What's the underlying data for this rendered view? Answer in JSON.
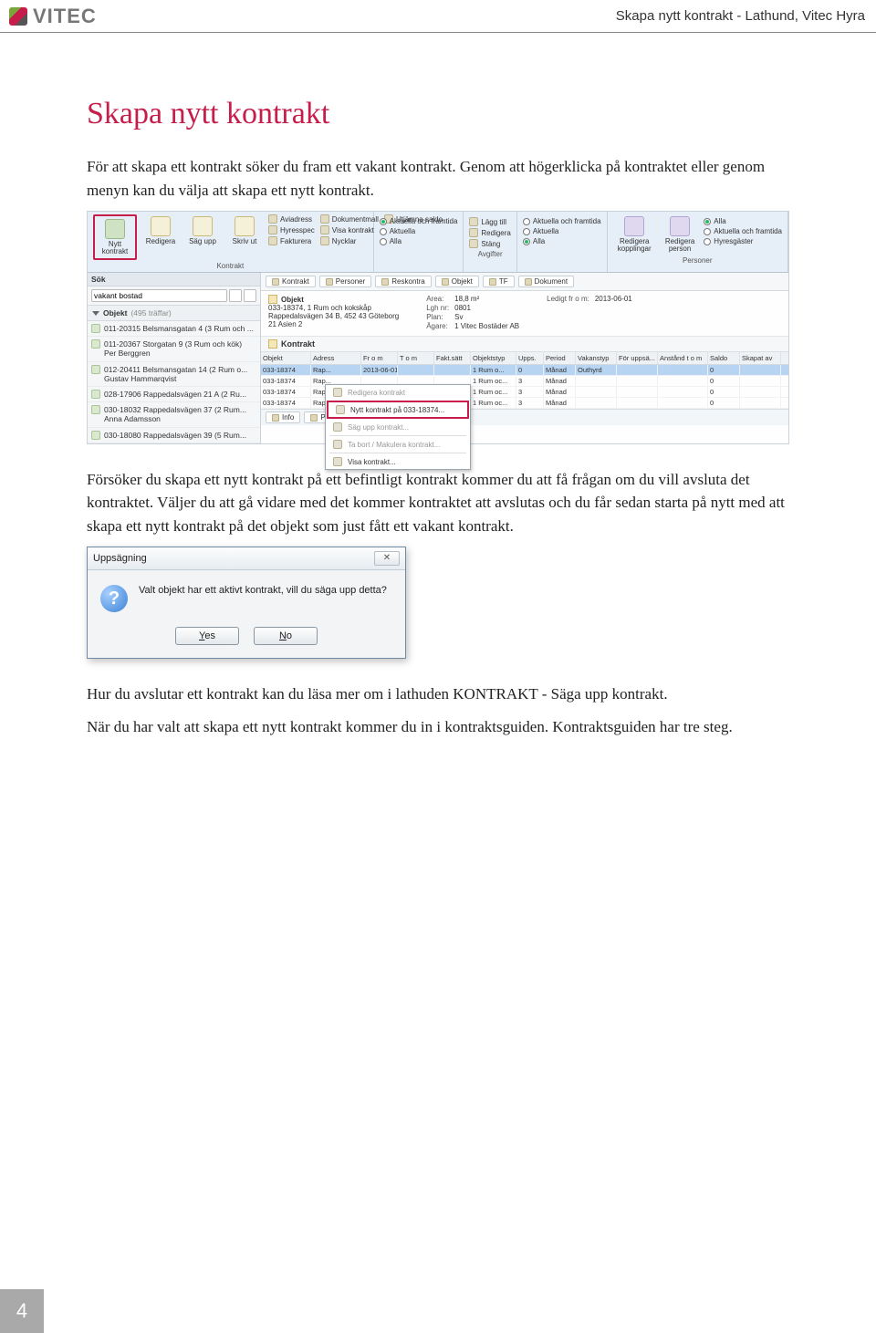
{
  "header": {
    "logo_text": "VITEC",
    "doc_title": "Skapa nytt kontrakt - Lathund, Vitec Hyra"
  },
  "h1": "Skapa nytt kontrakt",
  "para1": "För att skapa ett kontrakt söker du fram ett vakant kontrakt. Genom att högerklicka på kontraktet eller genom menyn kan du välja att skapa ett nytt kontrakt.",
  "para2": "Försöker du skapa ett nytt kontrakt på ett befintligt kontrakt kommer du att få frågan om du vill avsluta det kontraktet. Väljer du att gå vidare med det kommer kontraktet att avslutas och du får sedan starta på nytt med att skapa ett nytt kontrakt på det objekt som just fått ett vakant kontrakt.",
  "para3": "Hur du avslutar ett kontrakt kan du läsa mer om i lathuden KONTRAKT - Säga upp kontrakt.",
  "para4": "När du har valt att skapa ett nytt kontrakt kommer du in i kontraktsguiden. Kontraktsguiden har tre steg.",
  "page_number": "4",
  "screenshot1": {
    "ribbon": {
      "nytt": "Nytt kontrakt",
      "redigera": "Redigera",
      "sagupp": "Säg upp",
      "skrivut": "Skriv ut",
      "group1": "Kontrakt",
      "aviadress": "Aviadress",
      "hyresspec": "Hyresspec",
      "fakturera": "Fakturera",
      "dokumentmall": "Dokumentmall",
      "visakontrakt": "Visa kontrakt",
      "nycklar": "Nycklar",
      "utjamna": "Utjämna saldo",
      "aktuellaframtida": "Aktuella och framtida",
      "aktuella": "Aktuella",
      "alla": "Alla",
      "laggtill": "Lägg till",
      "redigera2": "Redigera",
      "stang": "Stäng",
      "group_avgifter": "Avgifter",
      "redkopp": "Redigera kopplingar",
      "redperson": "Redigera person",
      "hyresgaster": "Hyresgäster",
      "group_personer": "Personer"
    },
    "side": {
      "sok": "Sök",
      "search_value": "vakant bostad",
      "objekt_hdr": "Objekt",
      "objekt_hint": "(495 träffar)",
      "items": [
        "011-20315 Belsmansgatan 4 (3 Rum och ...",
        "011-20367 Storgatan 9 (3 Rum och kök) Per Berggren",
        "012-20411 Belsmansgatan 14 (2 Rum o... Gustav Hammarqvist",
        "028-17906 Rappedalsvägen 21 A (2 Ru...",
        "030-18032 Rappedalsvägen 37 (2 Rum... Anna Adamsson",
        "030-18080 Rappedalsvägen 39 (5 Rum..."
      ]
    },
    "tabs": [
      "Kontrakt",
      "Personer",
      "Reskontra",
      "Objekt",
      "TF",
      "Dokument"
    ],
    "objinfo": {
      "title": "Objekt",
      "id": "033-18374, 1 Rum och kokskåp",
      "addr": "Rappedalsvägen 34 B, 452 43 Göteborg",
      "fast": "21 Asien 2",
      "area_l": "Area:",
      "area_v": "18,8 m²",
      "lgh_l": "Lgh nr:",
      "lgh_v": "0801",
      "plan_l": "Plan:",
      "plan_v": "Sv",
      "agare_l": "Ägare:",
      "agare_v": "1 Vitec Bostäder AB",
      "ledig_l": "Ledigt fr o m:",
      "ledig_v": "2013-06-01"
    },
    "kontrakt_hdr": "Kontrakt",
    "cols": [
      "Objekt",
      "Adress",
      "Fr o m",
      "T o m",
      "Fakt.sätt",
      "Objektstyp",
      "Upps.",
      "Period",
      "Vakanstyp",
      "För uppsä...",
      "Anstånd t o m",
      "Saldo",
      "Skapat av"
    ],
    "rows": [
      {
        "objekt": "033-18374",
        "adress": "Rap...",
        "from": "2013-06-01",
        "tom": "",
        "fakt": "",
        "otyp": "1 Rum o...",
        "upps": "0",
        "period": "Månad",
        "vak": "Outhyrd",
        "for": "",
        "anst": "",
        "saldo": "0",
        "skap": ""
      },
      {
        "objekt": "033-18374",
        "adress": "Rap...",
        "from": "",
        "tom": "",
        "fakt": "",
        "otyp": "1 Rum oc...",
        "upps": "3",
        "period": "Månad",
        "vak": "",
        "for": "",
        "anst": "",
        "saldo": "0",
        "skap": ""
      },
      {
        "objekt": "033-18374",
        "adress": "Rap...",
        "from": "",
        "tom": "",
        "fakt": "",
        "otyp": "1 Rum oc...",
        "upps": "3",
        "period": "Månad",
        "vak": "",
        "for": "",
        "anst": "",
        "saldo": "0",
        "skap": ""
      },
      {
        "objekt": "033-18374",
        "adress": "Rap...",
        "from": "",
        "tom": "",
        "fakt": "",
        "otyp": "1 Rum oc...",
        "upps": "3",
        "period": "Månad",
        "vak": "",
        "for": "",
        "anst": "",
        "saldo": "0",
        "skap": ""
      }
    ],
    "context": {
      "redigera": "Redigera kontrakt",
      "nytt": "Nytt kontrakt på 033-18374...",
      "sagupp": "Säg upp kontrakt...",
      "tabort": "Ta bort / Makulera kontrakt...",
      "visa": "Visa kontrakt..."
    },
    "footer_tabs": [
      "Info",
      "Person"
    ]
  },
  "dialog": {
    "title": "Uppsägning",
    "text": "Valt objekt har ett aktivt kontrakt, vill du säga upp detta?",
    "yes": "Yes",
    "no": "No"
  }
}
